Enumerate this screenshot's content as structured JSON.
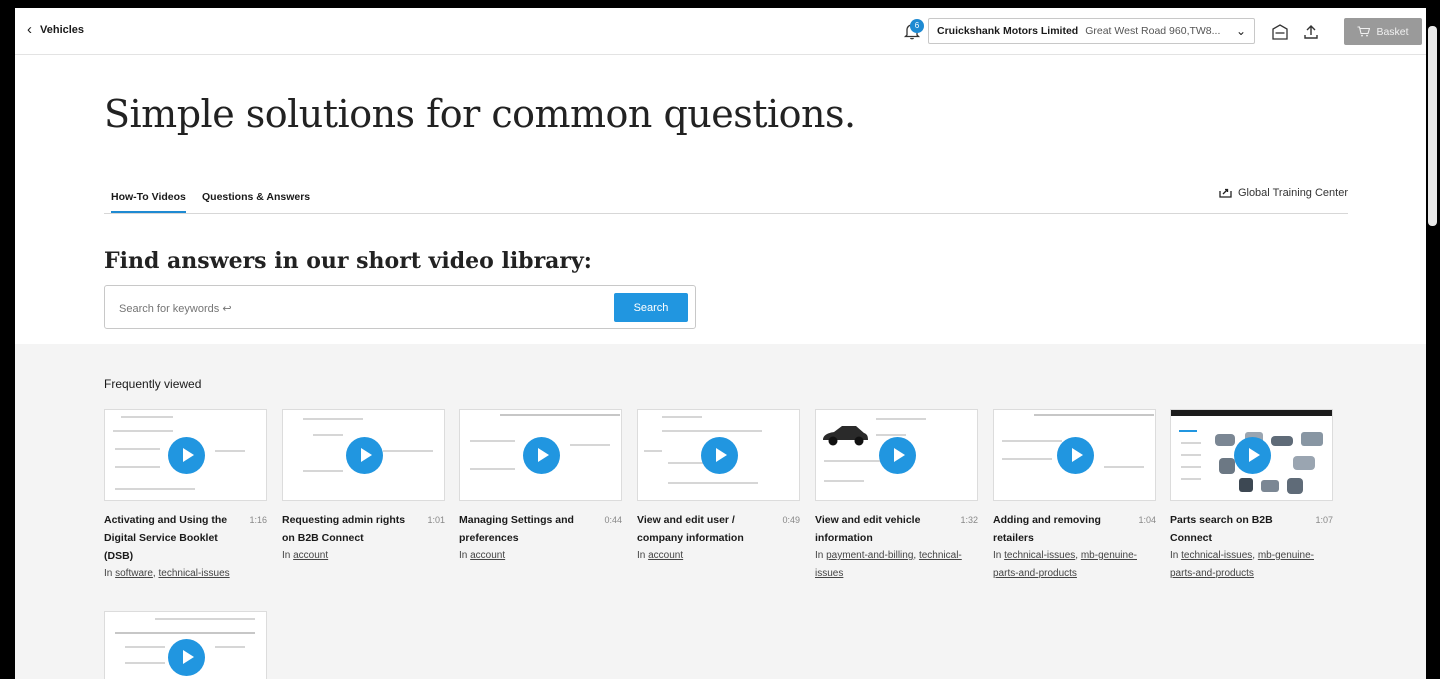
{
  "topbar": {
    "back_label": "Vehicles",
    "notification_count": "6",
    "dealer_name": "Cruickshank Motors Limited",
    "dealer_address": "Great West Road 960,TW8...",
    "basket_label": "Basket"
  },
  "hero": {
    "title": "Simple solutions for common questions."
  },
  "tabs": [
    {
      "label": "How-To Videos",
      "active": true
    },
    {
      "label": "Questions & Answers",
      "active": false
    }
  ],
  "training_link": "Global Training Center",
  "library": {
    "title": "Find answers in our short video library:",
    "search_placeholder": "Search for keywords ↩",
    "search_button": "Search"
  },
  "frequently_viewed": {
    "label": "Frequently viewed",
    "videos": [
      {
        "title": "Activating and Using the Digital Service Booklet (DSB)",
        "duration": "1:16",
        "prefix": "In",
        "links": [
          "software",
          "technical-issues"
        ]
      },
      {
        "title": "Requesting admin rights on B2B Connect",
        "duration": "1:01",
        "prefix": "In",
        "links": [
          "account"
        ]
      },
      {
        "title": "Managing Settings and preferences",
        "duration": "0:44",
        "prefix": "In",
        "links": [
          "account"
        ]
      },
      {
        "title": "View and edit user / company information",
        "duration": "0:49",
        "prefix": "In",
        "links": [
          "account"
        ]
      },
      {
        "title": "View and edit vehicle information",
        "duration": "1:32",
        "prefix": "In",
        "links": [
          "payment-and-billing",
          "technical-issues"
        ]
      },
      {
        "title": "Adding and removing retailers",
        "duration": "1:04",
        "prefix": "In",
        "links": [
          "technical-issues",
          "mb-genuine-parts-and-products"
        ]
      },
      {
        "title": "Parts search on B2B Connect",
        "duration": "1:07",
        "prefix": "In",
        "links": [
          "technical-issues",
          "mb-genuine-parts-and-products"
        ]
      }
    ]
  },
  "colors": {
    "accent": "#2196e0",
    "basket_bg": "#9a9a9a",
    "grey_bg": "#f4f4f4"
  }
}
